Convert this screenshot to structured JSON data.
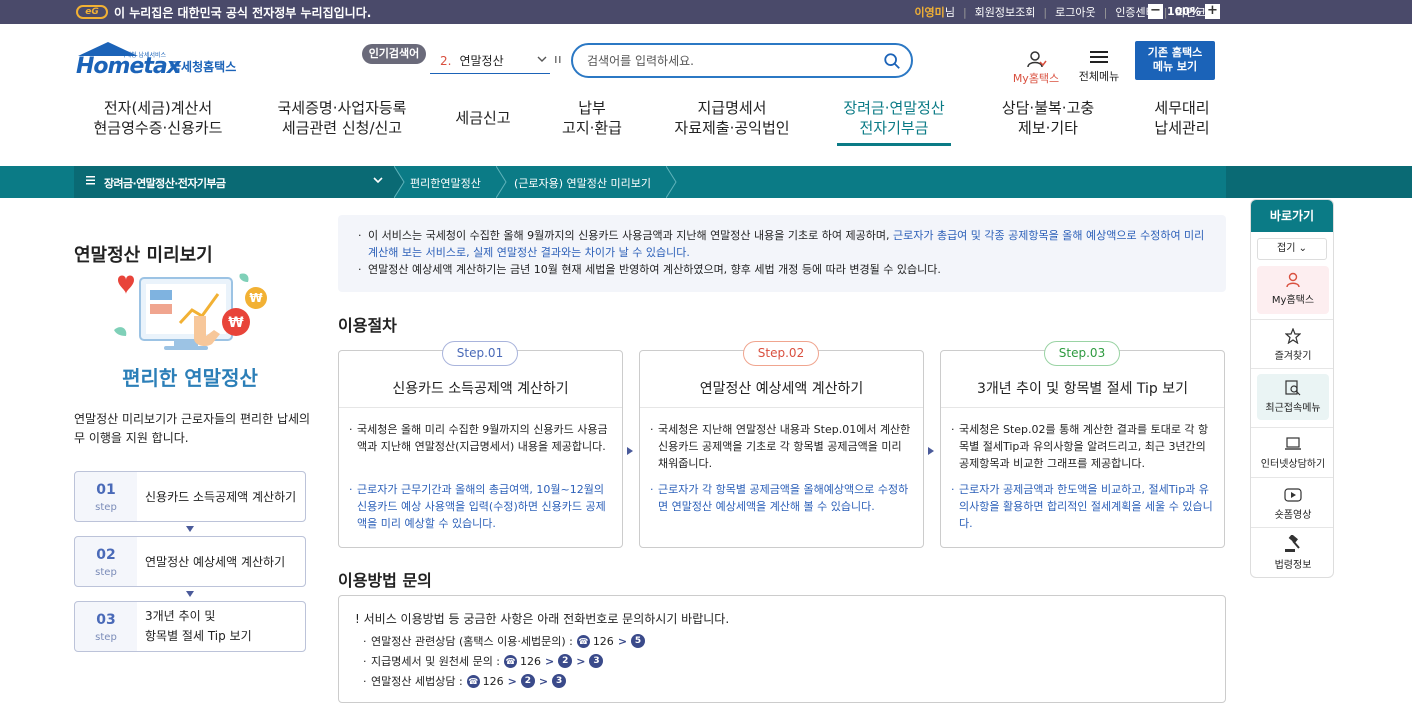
{
  "topbar": {
    "gov_logo": "eG",
    "gov_notice": "이 누리집은 대한민국 공식 전자정부 누리집입니다.",
    "user_name": "이영미",
    "user_suffix": "님",
    "links": [
      "회원정보조회",
      "로그아웃",
      "인증센터",
      "화면크기"
    ],
    "zoom_minus": "−",
    "zoom_level": "100%",
    "zoom_plus": "+"
  },
  "header": {
    "logo_main": "Hometax",
    "logo_sub": "국세청홈택스",
    "logo_tiny": "국세청 납세서비스",
    "popular_badge": "인기검색어",
    "popular_rank": "2.",
    "popular_term": "연말정산",
    "search_placeholder": "검색어를 입력하세요.",
    "my_hometax": "My홈택스",
    "all_menu": "전체메뉴",
    "classic_line1": "기존 홈택스",
    "classic_line2": "메뉴 보기"
  },
  "gnb": [
    {
      "l1": "전자(세금)계산서",
      "l2": "현금영수증·신용카드"
    },
    {
      "l1": "국세증명·사업자등록",
      "l2": "세금관련 신청/신고"
    },
    {
      "l1": "세금신고",
      "l2": ""
    },
    {
      "l1": "납부",
      "l2": "고지·환급"
    },
    {
      "l1": "지급명세서",
      "l2": "자료제출·공익법인"
    },
    {
      "l1": "장려금·연말정산",
      "l2": "전자기부금"
    },
    {
      "l1": "상담·불복·고충",
      "l2": "제보·기타"
    },
    {
      "l1": "세무대리",
      "l2": "납세관리"
    }
  ],
  "breadcrumb": {
    "level1": "장려금·연말정산·전자기부금",
    "level2": "편리한연말정산",
    "level3": "(근로자용) 연말정산 미리보기"
  },
  "left": {
    "title": "연말정산 미리보기",
    "subtitle": "편리한 연말정산",
    "desc": "연말정산 미리보기가 근로자들의 편리한 납세의무 이행을 지원 합니다.",
    "step_word": "step",
    "steps": [
      {
        "num": "01",
        "label": "신용카드 소득공제액 계산하기"
      },
      {
        "num": "02",
        "label": "연말정산 예상세액 계산하기"
      },
      {
        "num": "03",
        "label1": "3개년 추이 및",
        "label2": "항목별 절세 Tip 보기"
      }
    ]
  },
  "notice": {
    "line1_a": "이 서비스는 국세청이 수집한 올해 9월까지의 신용카드 사용금액과 지난해 연말정산 내용을 기초로 하여 제공하며, ",
    "line1_b": "근로자가 총급여 및 각종 공제항목을 올해 예상액으로 수정하여 미리 계산해 보는 서비스로, 실제 연말정산 결과와는 차이가 날 수 있습니다.",
    "line2": "연말정산 예상세액 계산하기는 금년 10월 현재 세법을 반영하여 계산하였으며, 향후 세법 개정 등에 따라 변경될 수 있습니다."
  },
  "procedure": {
    "title": "이용절차",
    "steps": [
      {
        "badge": "Step.01",
        "badge_color": "#4a6ab8",
        "badge_border": "#a9b4dc",
        "title": "신용카드 소득공제액 계산하기",
        "text1": "국세청은 올해 미리 수집한 9월까지의 신용카드 사용금액과 지난해 연말정산(지급명세서) 내용을 제공합니다.",
        "text2": "근로자가 근무기간과 올해의 총급여액, 10월~12월의 신용카드 예상 사용액을 입력(수정)하면 신용카드 공제액을 미리 예상할 수 있습니다."
      },
      {
        "badge": "Step.02",
        "badge_color": "#d9503f",
        "badge_border": "#f0a58f",
        "title": "연말정산 예상세액 계산하기",
        "text1": "국세청은 지난해 연말정산 내용과 Step.01에서 계산한 신용카드 공제액을 기초로 각 항목별 공제금액을 미리 채워줍니다.",
        "text2": "근로자가 각 항목별 공제금액을 올해예상액으로 수정하면 연말정산 예상세액을 계산해 볼 수 있습니다."
      },
      {
        "badge": "Step.03",
        "badge_color": "#2e9a3f",
        "badge_border": "#9ad3a4",
        "title": "3개년 추이 및 항목별 절세 Tip 보기",
        "text1": "국세청은 Step.02를 통해 계산한 결과를 토대로 각 항목별 절세Tip과 유의사항을 알려드리고, 최근 3년간의 공제항목과 비교한 그래프를 제공합니다.",
        "text2": "근로자가 공제금액과 한도액을 비교하고, 절세Tip과 유의사항을 활용하면 합리적인 절세계획을 세울 수 있습니다."
      }
    ]
  },
  "inquiry": {
    "title": "이용방법 문의",
    "head": "! 서비스 이용방법 등 궁금한 사항은 아래 전화번호로 문의하시기 바랍니다.",
    "rows": [
      {
        "label": "연말정산 관련상담 (홈택스 이용·세법문의) :",
        "number": "126",
        "keys": [
          "5"
        ]
      },
      {
        "label": "지급명세서 및 원천세 문의 :",
        "number": "126",
        "keys": [
          "2",
          "3"
        ]
      },
      {
        "label": "연말정산 세법상담 :",
        "number": "126",
        "keys": [
          "2",
          "3"
        ]
      }
    ]
  },
  "quick": {
    "title": "바로가기",
    "fold": "접기",
    "items": [
      "My홈택스",
      "즐겨찾기",
      "최근접속메뉴",
      "인터넷상담하기",
      "숏폼영상",
      "법령정보"
    ]
  },
  "colors": {
    "primary_blue": "#1b63b8",
    "teal": "#0b7b86",
    "notice_blue": "#2b5fb8"
  }
}
